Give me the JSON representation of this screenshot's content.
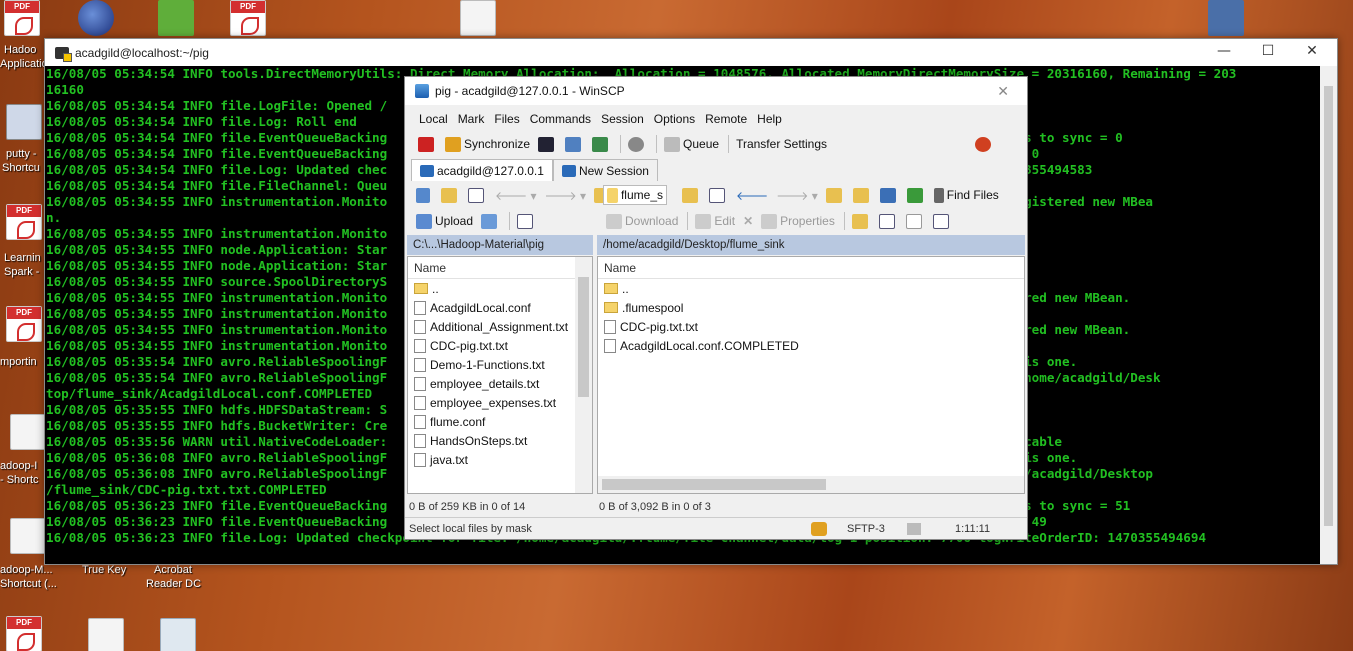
{
  "desktop": {
    "icons": [
      {
        "label": "Hadoo",
        "label2": "Applicatio"
      },
      {
        "label": "putty -",
        "label2": "Shortcu"
      },
      {
        "label": "Learnin",
        "label2": "Spark -"
      },
      {
        "label": "mportin",
        "label2": ""
      },
      {
        "label": "adoop-I",
        "label2": "- Shortc"
      },
      {
        "label": "adoop-M...",
        "label2": "Shortcut (..."
      },
      {
        "label": "True Key",
        "label2": ""
      },
      {
        "label": "Acrobat",
        "label2": "Reader DC"
      }
    ]
  },
  "terminal": {
    "title": "acadgild@localhost:~/pig",
    "lines": [
      "16/08/05 05:34:54 INFO tools.DirectMemoryUtils: Direct Memory Allocation:  Allocation = 1048576, Allocated MemoryDirectMemorySize = 20316160, Remaining = 203",
      "16160",
      "16/08/05 05:34:54 INFO file.LogFile: Opened /",
      "16/08/05 05:34:54 INFO file.Log: Roll end",
      "16/08/05 05:34:54 INFO file.EventQueueBacking                                                                 checkpoint, elements to sync = 0",
      "16/08/05 05:34:54 INFO file.EventQueueBacking                                                                 Size: 0, queueHead: 0",
      "16/08/05 05:34:54 INFO file.Log: Updated chec                                                                 gWriteOrderID: 1470355494583",
      "16/08/05 05:34:54 INFO file.FileChannel: Queu",
      "16/08/05 05:34:55 INFO instrumentation.Monito                                                                 _1: Successfully registered new MBea",
      "n.",
      "16/08/05 05:34:55 INFO instrumentation.Monito",
      "16/08/05 05:34:55 INFO node.Application: Star",
      "16/08/05 05:34:55 INFO node.Application: Star",
      "16/08/05 05:34:55 INFO source.SpoolDirectoryS                                                                 ktop/flume_sink",
      "16/08/05 05:34:55 INFO instrumentation.Monito                                                                 uccessfully registered new MBean.",
      "16/08/05 05:34:55 INFO instrumentation.Monito",
      "16/08/05 05:34:55 INFO instrumentation.Monito                                                                 uccessfully registered new MBean.",
      "16/08/05 05:34:55 INFO instrumentation.Monito",
      "16/08/05 05:35:54 INFO avro.ReliableSpoolingF                                                                 ext file, if there is one.",
      "16/08/05 05:35:54 INFO avro.ReliableSpoolingF                                                                 gildLocal.conf to /home/acadgild/Desk",
      "top/flume_sink/AcadgildLocal.conf.COMPLETED",
      "16/08/05 05:35:55 INFO hdfs.HDFSDataStream: S",
      "16/08/05 05:35:55 INFO hdfs.BucketWriter: Cre",
      "16/08/05 05:35:56 WARN util.NativeCodeLoader:                                                                 classes where applicable",
      "16/08/05 05:36:08 INFO avro.ReliableSpoolingF                                                                 ext file, if there is one.",
      "16/08/05 05:36:08 INFO avro.ReliableSpoolingF                                                                 ig.txt.txt to /home/acadgild/Desktop",
      "/flume_sink/CDC-pig.txt.txt.COMPLETED",
      "16/08/05 05:36:23 INFO file.EventQueueBacking                                                                 checkpoint, elements to sync = 51",
      "16/08/05 05:36:23 INFO file.EventQueueBacking                                                                 Size: 0, queueHead: 49",
      "16/08/05 05:36:23 INFO file.Log: Updated checkpoint for file: /home/acadgild/.flume/file-channel/data/log-1 position: 7706 logWriteOrderID: 1470355494694",
      ""
    ]
  },
  "winscp": {
    "title": "pig - acadgild@127.0.0.1 - WinSCP",
    "menu": [
      "Local",
      "Mark",
      "Files",
      "Commands",
      "Session",
      "Options",
      "Remote",
      "Help"
    ],
    "toolbar": {
      "synchronize": "Synchronize",
      "queue": "Queue",
      "transfer_settings": "Transfer Settings"
    },
    "tabs": {
      "session": "acadgild@127.0.0.1",
      "new_session": "New Session"
    },
    "remote_dir_combo": "flume_s",
    "find_files": "Find Files",
    "actions": {
      "upload": "Upload",
      "download": "Download",
      "edit": "Edit",
      "properties": "Properties"
    },
    "local": {
      "path": "C:\\...\\Hadoop-Material\\pig",
      "column": "Name",
      "files": [
        "..",
        "AcadgildLocal.conf",
        "Additional_Assignment.txt",
        "CDC-pig.txt.txt",
        "Demo-1-Functions.txt",
        "employee_details.txt",
        "employee_expenses.txt",
        "flume.conf",
        "HandsOnSteps.txt",
        "java.txt"
      ],
      "status": "0 B of 259 KB in 0 of 14"
    },
    "remote": {
      "path": "/home/acadgild/Desktop/flume_sink",
      "column": "Name",
      "files": [
        "..",
        ".flumespool",
        "CDC-pig.txt.txt",
        "AcadgildLocal.conf.COMPLETED"
      ],
      "status": "0 B of 3,092 B in 0 of 3"
    },
    "statusbar": {
      "hint": "Select local files by mask",
      "protocol": "SFTP-3",
      "time": "1:11:11"
    }
  }
}
